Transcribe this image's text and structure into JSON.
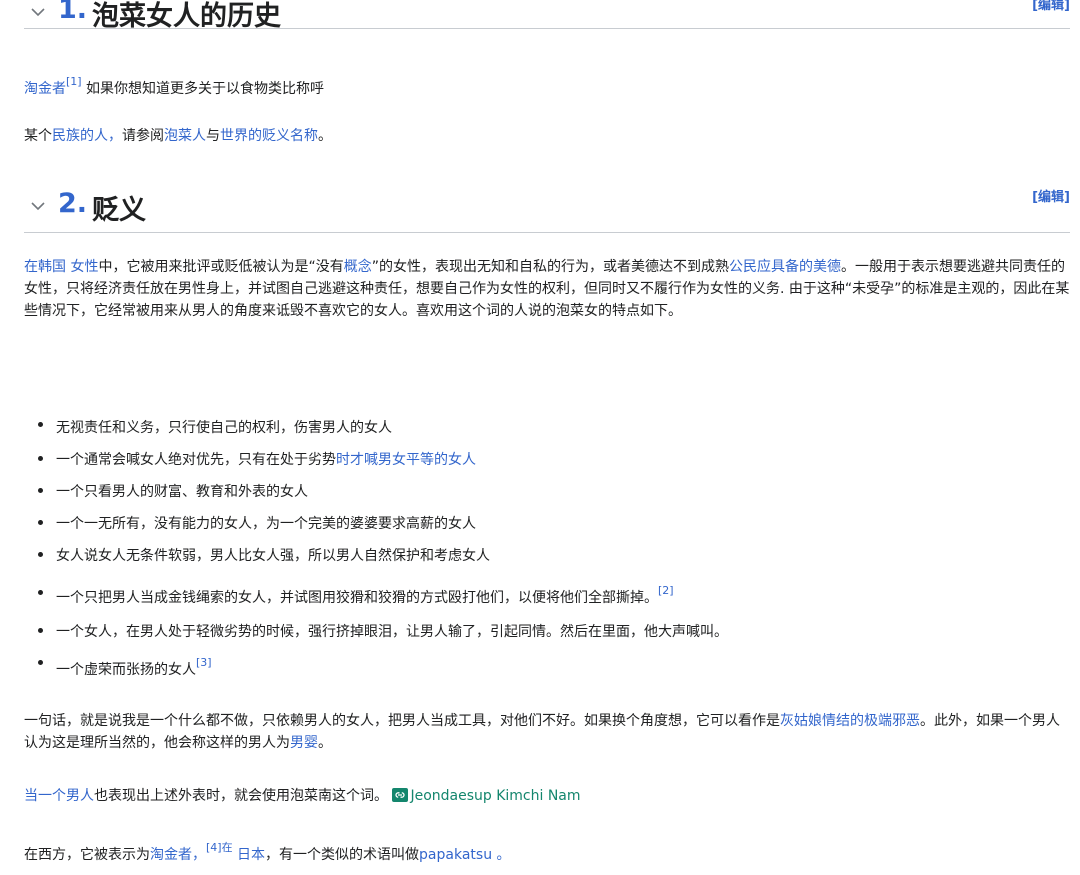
{
  "section1": {
    "number": "1.",
    "title": "泡菜女人的历史",
    "edit": "[编辑]",
    "para1": {
      "link": "淘金者",
      "ref": "[1]",
      "text": "如果你想知道更多关于以食物类比称呼"
    },
    "para2": {
      "t1": "某个",
      "link1": "民族的人，",
      "t2": "请参阅",
      "link2": "泡菜人",
      "t3": "与",
      "link3": "世界的贬义名称",
      "t4": "。"
    }
  },
  "section2": {
    "number": "2.",
    "title": "贬义",
    "edit": "[编辑]",
    "intro": {
      "link1": "在韩国",
      "link2": "女性",
      "t1": "中，它被用来批评或贬低被认为是“没有",
      "link3": "概念",
      "t2": "”的女性，表现出无知和自私的行为，或者美德达不到成熟",
      "link4": "公民应具备的美德",
      "t3": "。一般用于表示想要逃避共同责任的女性，只将经济责任放在男性身上，并试图自己逃避这种责任，想要自己作为女性的权利，但同时又不履行作为女性的义务. 由于这种“未受孕”的标准是主观的，因此在某些情况下，它经常被用来从男人的角度来诋毁不喜欢它的女人。喜欢用这个词的人说的泡菜女的特点如下。"
    },
    "bullets": {
      "b1": "无视责任和义务，只行使自己的权利，伤害男人的女人",
      "b2_text": "一个通常会喊女人绝对优先，只有在处于劣势",
      "b2_link": "时才喊男女平等的女人",
      "b3": "一个只看男人的财富、教育和外表的女人",
      "b4": "一个一无所有，没有能力的女人，为一个完美的婆婆要求高薪的女人",
      "b5": "女人说女人无条件软弱，男人比女人强，所以男人自然保护和考虑女人",
      "b6_text": "一个只把男人当成金钱绳索的女人，并试图用狡猾和狡猾的方式殴打他们，以便将他们全部撕掉。",
      "b6_ref": "[2]",
      "b7": "一个女人，在男人处于轻微劣势的时候，强行挤掉眼泪，让男人输了，引起同情。然后在里面，他大声喊叫。",
      "b8_text": "一个虚荣而张扬的女人",
      "b8_ref": "[3]"
    },
    "summary": {
      "t1": "一句话，就是说我是一个什么都不做，只依赖男人的女人，把男人当成工具，对他们不好。如果换个角度想，它可以看作是",
      "link1": "灰姑娘情结的极端邪恶",
      "t2": "。此外，如果一个男人认为这是理所当然的，他会称这样的男人为",
      "link2": "男婴",
      "t3": "。"
    },
    "men": {
      "link1": "当一个男人",
      "t1": "也表现出上述外表时，就会使用泡菜南这个词。",
      "icon": "external-link-icon",
      "ext": "Jeondaesup Kimchi Nam"
    },
    "west": {
      "t1": "在西方，它被表示为",
      "link1": "淘金者，",
      "ref": "[4]在",
      "link2": "日本",
      "t2": "，有一个类似的术语叫做",
      "link3": "papakatsu",
      "link4": "。"
    }
  },
  "colors": {
    "link": "#3366cc",
    "text": "#202122",
    "external": "#14866d",
    "divider": "#c8ccd1"
  }
}
